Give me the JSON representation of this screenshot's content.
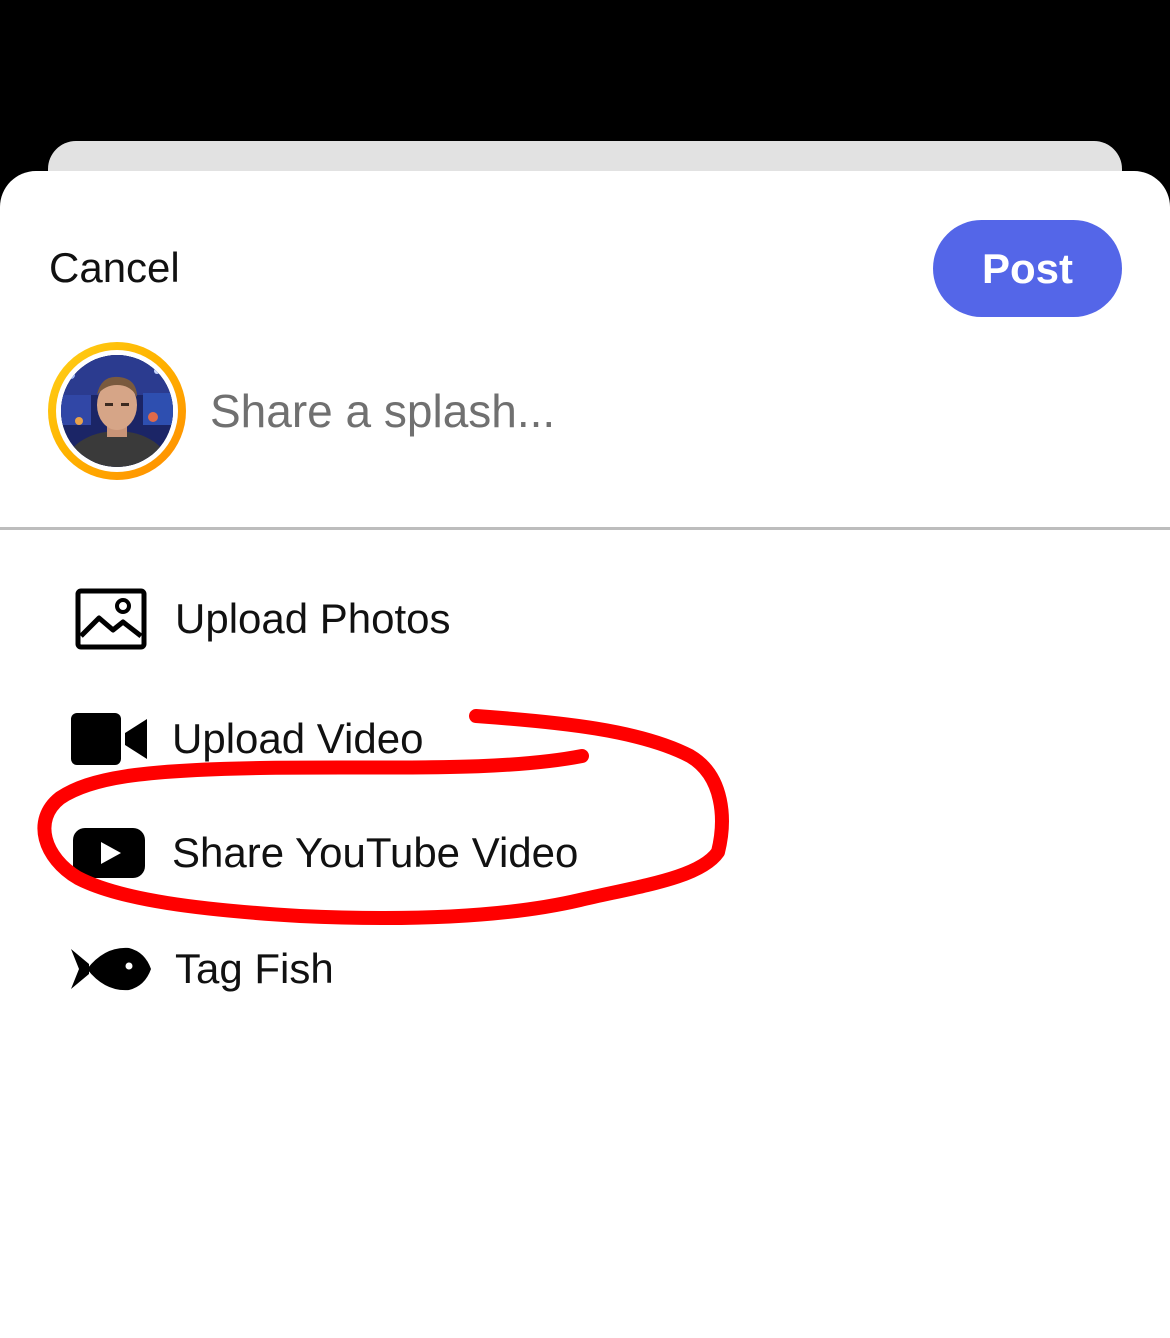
{
  "header": {
    "cancel_label": "Cancel",
    "post_label": "Post"
  },
  "composer": {
    "placeholder": "Share a splash..."
  },
  "actions": [
    {
      "label": "Upload Photos",
      "icon": "image-icon"
    },
    {
      "label": "Upload Video",
      "icon": "video-camera-icon"
    },
    {
      "label": "Share YouTube Video",
      "icon": "youtube-icon"
    },
    {
      "label": "Tag Fish",
      "icon": "fish-icon"
    }
  ],
  "colors": {
    "accent": "#5466e8",
    "avatar_ring": "#ffb400",
    "annotation": "#ff0000"
  }
}
